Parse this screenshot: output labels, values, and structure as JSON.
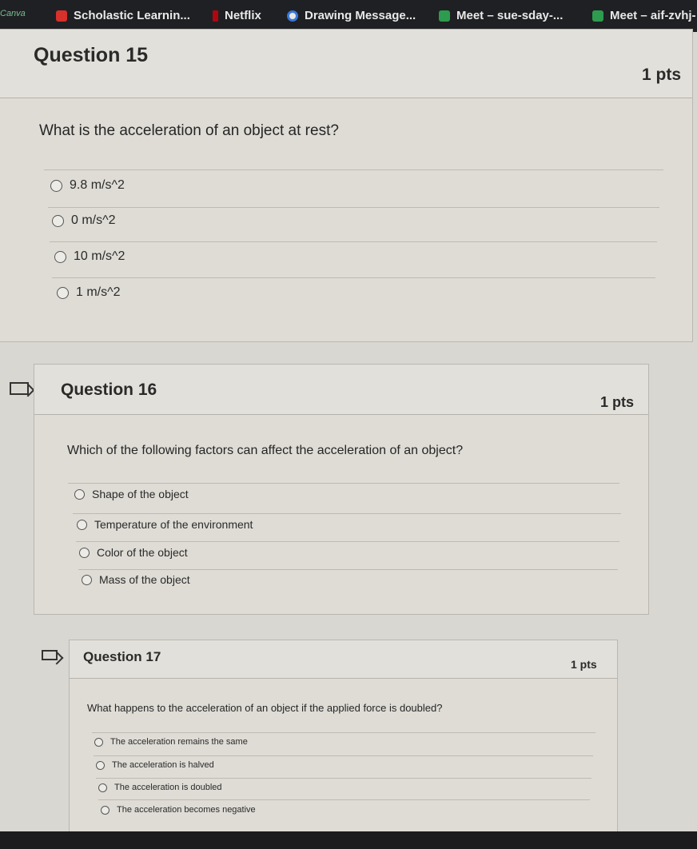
{
  "bookmarks": [
    {
      "label": "Canva",
      "icon": "canva-icon"
    },
    {
      "label": "Scholastic Learnin...",
      "icon": "scholastic-icon"
    },
    {
      "label": "Netflix",
      "icon": "netflix-icon"
    },
    {
      "label": "Drawing Message...",
      "icon": "drawing-icon"
    },
    {
      "label": "Meet – sue-sday-...",
      "icon": "meet-icon"
    },
    {
      "label": "Meet – aif-zvhj-",
      "icon": "meet-icon"
    }
  ],
  "questions": [
    {
      "title": "Question 15",
      "points": "1 pts",
      "text": "What is the acceleration of an object at rest?",
      "options": [
        "9.8 m/s^2",
        "0 m/s^2",
        "10 m/s^2",
        "1 m/s^2"
      ]
    },
    {
      "title": "Question 16",
      "points": "1 pts",
      "text": "Which of the following factors can affect the acceleration of an object?",
      "options": [
        "Shape of the object",
        "Temperature of the environment",
        "Color of the object",
        "Mass of the object"
      ]
    },
    {
      "title": "Question 17",
      "points": "1 pts",
      "text": "What happens to the acceleration of an object if the applied force is doubled?",
      "options": [
        "The acceleration remains the same",
        "The acceleration is halved",
        "The acceleration is doubled",
        "The acceleration becomes negative"
      ]
    }
  ]
}
